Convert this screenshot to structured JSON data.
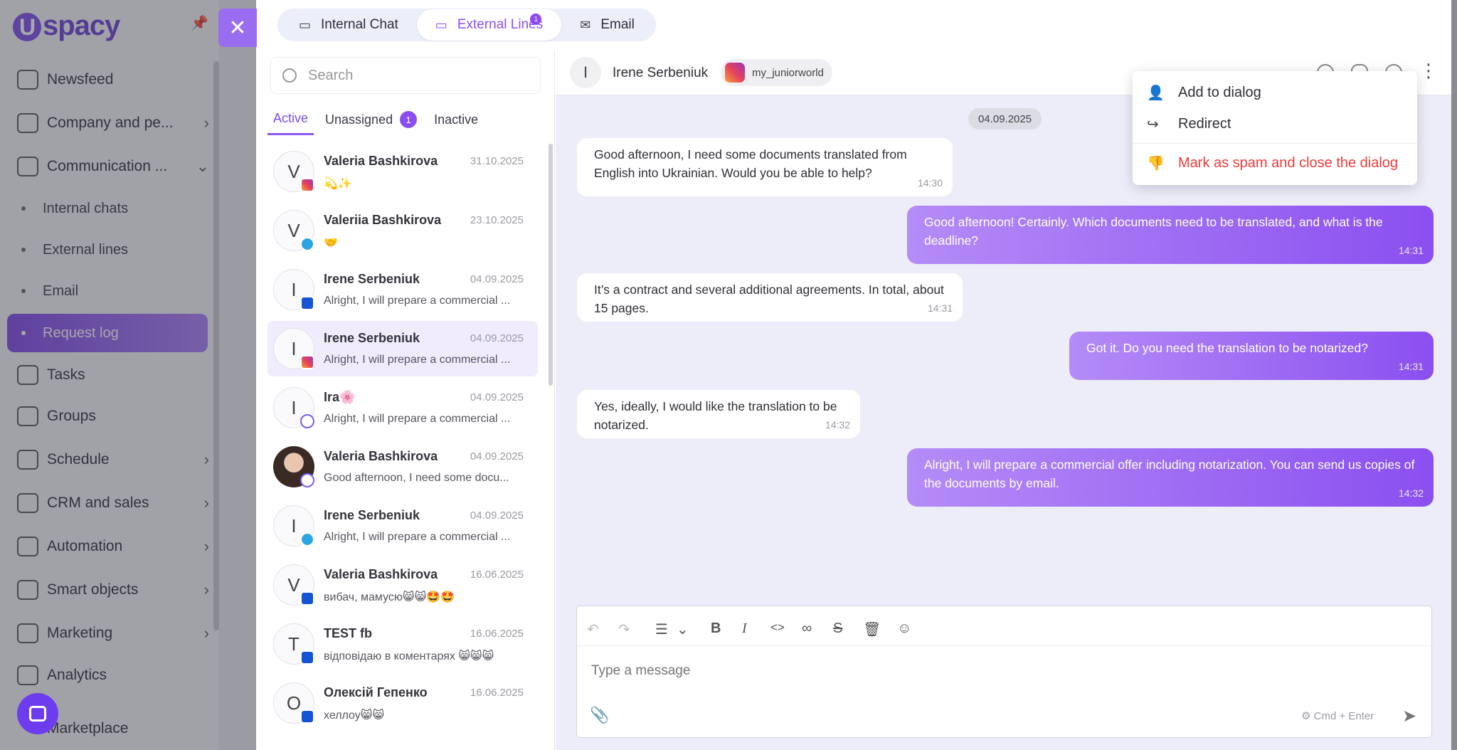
{
  "app": {
    "logo_text": "spacy",
    "logo_letter": "U"
  },
  "sidebar": {
    "items": [
      {
        "label": "Newsfeed"
      },
      {
        "label": "Company and pe..."
      },
      {
        "label": "Communication ..."
      },
      {
        "label": "Tasks"
      },
      {
        "label": "Groups"
      },
      {
        "label": "Schedule"
      },
      {
        "label": "CRM and sales"
      },
      {
        "label": "Automation"
      },
      {
        "label": "Smart objects"
      },
      {
        "label": "Marketing"
      },
      {
        "label": "Analytics"
      },
      {
        "label": "Marketplace"
      }
    ],
    "sub_items": [
      {
        "label": "Internal chats"
      },
      {
        "label": "External lines"
      },
      {
        "label": "Email"
      },
      {
        "label": "Request log"
      }
    ]
  },
  "top_tabs": [
    {
      "label": "Internal Chat"
    },
    {
      "label": "External Lines",
      "badge": "1"
    },
    {
      "label": "Email"
    }
  ],
  "search": {
    "placeholder": "Search"
  },
  "list_tabs": [
    {
      "label": "Active"
    },
    {
      "label": "Unassigned",
      "count": "1"
    },
    {
      "label": "Inactive"
    }
  ],
  "dialogs": [
    {
      "initial": "V",
      "name": "Valeria Bashkirova",
      "date": "31.10.2025",
      "preview": "💫✨",
      "channel": "instagram"
    },
    {
      "initial": "V",
      "name": "Valeriia Bashkirova",
      "date": "23.10.2025",
      "preview": "🤝",
      "channel": "telegram"
    },
    {
      "initial": "I",
      "name": "Irene Serbeniuk",
      "date": "04.09.2025",
      "preview": "Alright, I will prepare a commercial ...",
      "channel": "facebook"
    },
    {
      "initial": "I",
      "name": "Irene Serbeniuk",
      "date": "04.09.2025",
      "preview": "Alright, I will prepare a commercial ...",
      "channel": "instagram"
    },
    {
      "initial": "I",
      "name": "Ira🌸",
      "date": "04.09.2025",
      "preview": "Alright, I will prepare a commercial ...",
      "channel": "viber"
    },
    {
      "initial": "",
      "name": "Valeria Bashkirova",
      "date": "04.09.2025",
      "preview": "Good afternoon, I need some docu...",
      "channel": "viber"
    },
    {
      "initial": "I",
      "name": "Irene Serbeniuk",
      "date": "04.09.2025",
      "preview": "Alright, I will prepare a commercial ...",
      "channel": "telegram"
    },
    {
      "initial": "V",
      "name": "Valeria Bashkirova",
      "date": "16.06.2025",
      "preview": "вибач, мамусю😸😸🤩🤩",
      "channel": "facebook"
    },
    {
      "initial": "T",
      "name": "TEST fb",
      "date": "16.06.2025",
      "preview": "відповідаю в коментарях 😸😸😸",
      "channel": "facebook"
    },
    {
      "initial": "О",
      "name": "Олексій Гепенко",
      "date": "16.06.2025",
      "preview": "хеллоу😸😸",
      "channel": "facebook"
    }
  ],
  "conversation": {
    "contact_initial": "I",
    "contact_name": "Irene Serbeniuk",
    "account": "my_juniorworld",
    "date": "04.09.2025",
    "messages": [
      {
        "text": "Good afternoon, I need some documents translated from English into Ukrainian. Would you be able to help?",
        "time": "14:30"
      },
      {
        "text": "Good afternoon! Certainly. Which documents need to be translated, and what is the deadline?",
        "time": "14:31"
      },
      {
        "text": "It’s a contract and several additional agreements. In total, about 15 pages.",
        "time": "14:31"
      },
      {
        "text": "Got it. Do you need the translation to be notarized?",
        "time": "14:31"
      },
      {
        "text": "Yes, ideally, I would like the translation to be notarized.",
        "time": "14:32"
      },
      {
        "text": "Alright, I will prepare a commercial offer including notarization. You can send us copies of the documents by email.",
        "time": "14:32"
      }
    ]
  },
  "composer": {
    "placeholder": "Type a message",
    "hint": "Cmd + Enter"
  },
  "context_menu": {
    "add": "Add to dialog",
    "redirect": "Redirect",
    "spam": "Mark as spam and close the dialog"
  }
}
